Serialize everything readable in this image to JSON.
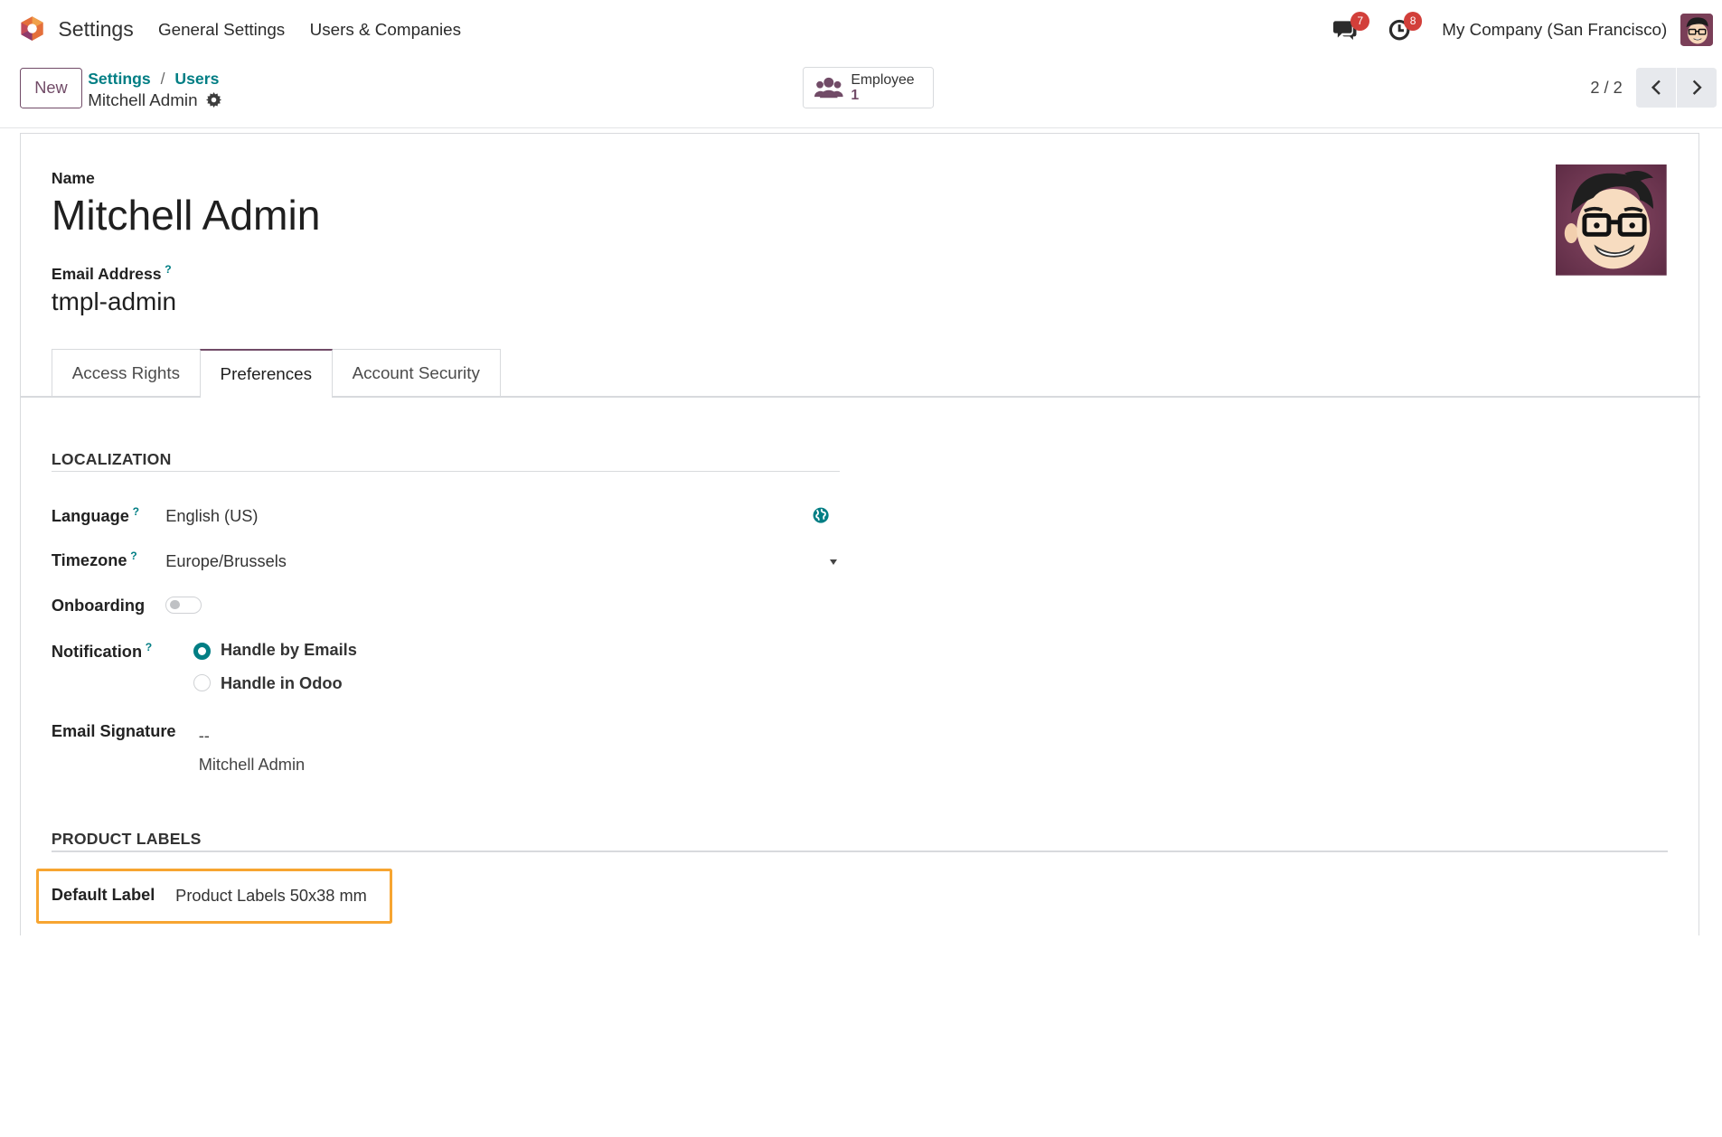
{
  "navbar": {
    "app_title": "Settings",
    "menu": [
      "General Settings",
      "Users & Companies"
    ],
    "messages_count": "7",
    "activities_count": "8",
    "company": "My Company (San Francisco)"
  },
  "control_panel": {
    "new_label": "New",
    "breadcrumb": [
      "Settings",
      "Users"
    ],
    "breadcrumb_sep": "/",
    "record_title": "Mitchell Admin",
    "smart_button": {
      "label": "Employee",
      "value": "1"
    },
    "pager": "2 / 2"
  },
  "form": {
    "name_label": "Name",
    "name": "Mitchell Admin",
    "email_label": "Email Address",
    "email": "tmpl-admin",
    "help_mark": "?",
    "tabs": [
      {
        "label": "Access Rights",
        "active": false
      },
      {
        "label": "Preferences",
        "active": true
      },
      {
        "label": "Account Security",
        "active": false
      }
    ],
    "localization": {
      "title": "LOCALIZATION",
      "language_label": "Language",
      "language": "English (US)",
      "timezone_label": "Timezone",
      "timezone": "Europe/Brussels",
      "onboarding_label": "Onboarding",
      "onboarding_enabled": false,
      "notification_label": "Notification",
      "notification_options": [
        "Handle by Emails",
        "Handle in Odoo"
      ],
      "notification_selected": "Handle by Emails",
      "signature_label": "Email Signature",
      "signature_lines": [
        "--",
        "Mitchell Admin"
      ]
    },
    "product_labels": {
      "title": "PRODUCT LABELS",
      "default_label_label": "Default Label",
      "default_label": "Product Labels 50x38 mm"
    }
  },
  "colors": {
    "brand": "#714b67",
    "accent": "#017e84",
    "badge": "#d23f3a",
    "highlight": "#f7a531"
  },
  "icons": [
    "odoo-logo-icon",
    "chat-icon",
    "clock-icon",
    "gear-icon",
    "users-icon",
    "chevron-left-icon",
    "chevron-right-icon",
    "globe-icon",
    "caret-down-icon"
  ]
}
